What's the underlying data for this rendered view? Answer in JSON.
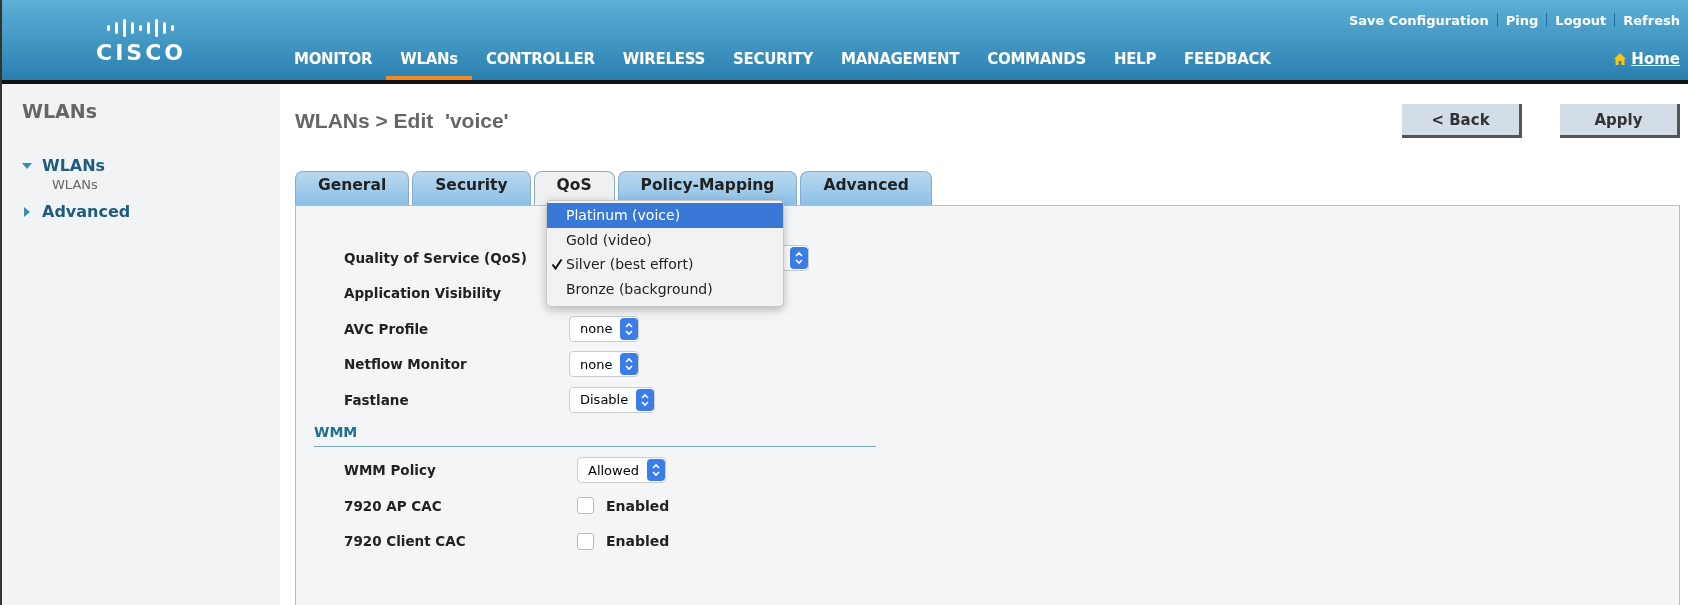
{
  "header": {
    "logo": "CISCO",
    "top_links": [
      {
        "label": "Save Configuration"
      },
      {
        "label": "Ping"
      },
      {
        "label": "Logout"
      },
      {
        "label": "Refresh"
      }
    ],
    "nav": [
      {
        "label": "MONITOR",
        "selected": false
      },
      {
        "label": "WLANs",
        "selected": true
      },
      {
        "label": "CONTROLLER",
        "selected": false
      },
      {
        "label": "WIRELESS",
        "selected": false
      },
      {
        "label": "SECURITY",
        "selected": false
      },
      {
        "label": "MANAGEMENT",
        "selected": false
      },
      {
        "label": "COMMANDS",
        "selected": false
      },
      {
        "label": "HELP",
        "selected": false
      },
      {
        "label": "FEEDBACK",
        "selected": false
      }
    ],
    "home": "Home"
  },
  "sidebar": {
    "title": "WLANs",
    "items": [
      {
        "label": "WLANs",
        "expanded": true,
        "children": [
          {
            "label": "WLANs"
          }
        ]
      },
      {
        "label": "Advanced",
        "expanded": false
      }
    ]
  },
  "page": {
    "title": "WLANs > Edit  'voice'",
    "buttons": [
      {
        "label": "< Back"
      },
      {
        "label": "Apply"
      }
    ],
    "tabs": [
      {
        "label": "General",
        "selected": false
      },
      {
        "label": "Security",
        "selected": false
      },
      {
        "label": "QoS",
        "selected": true
      },
      {
        "label": "Policy-Mapping",
        "selected": false
      },
      {
        "label": "Advanced",
        "selected": false
      }
    ],
    "rows": [
      {
        "kind": "select",
        "label": "Quality of Service (QoS)"
      },
      {
        "kind": "label_only",
        "label": "Application Visibility"
      },
      {
        "kind": "select",
        "label": "AVC Profile",
        "value": "none"
      },
      {
        "kind": "select",
        "label": "Netflow Monitor",
        "value": "none"
      },
      {
        "kind": "select",
        "label": "Fastlane",
        "value": "Disable"
      },
      {
        "kind": "section",
        "label": "WMM"
      },
      {
        "kind": "select",
        "label": "WMM Policy",
        "value": "Allowed"
      },
      {
        "kind": "checkbox",
        "label": "7920 AP CAC",
        "text": "Enabled",
        "checked": false
      },
      {
        "kind": "checkbox",
        "label": "7920 Client CAC",
        "text": "Enabled",
        "checked": false
      }
    ],
    "qos_menu": [
      {
        "label": "Platinum (voice)",
        "selected": false,
        "highlighted": true
      },
      {
        "label": "Gold (video)",
        "selected": false,
        "highlighted": false
      },
      {
        "label": "Silver (best effort)",
        "selected": true,
        "highlighted": false
      },
      {
        "label": "Bronze (background)",
        "selected": false,
        "highlighted": false
      }
    ]
  }
}
